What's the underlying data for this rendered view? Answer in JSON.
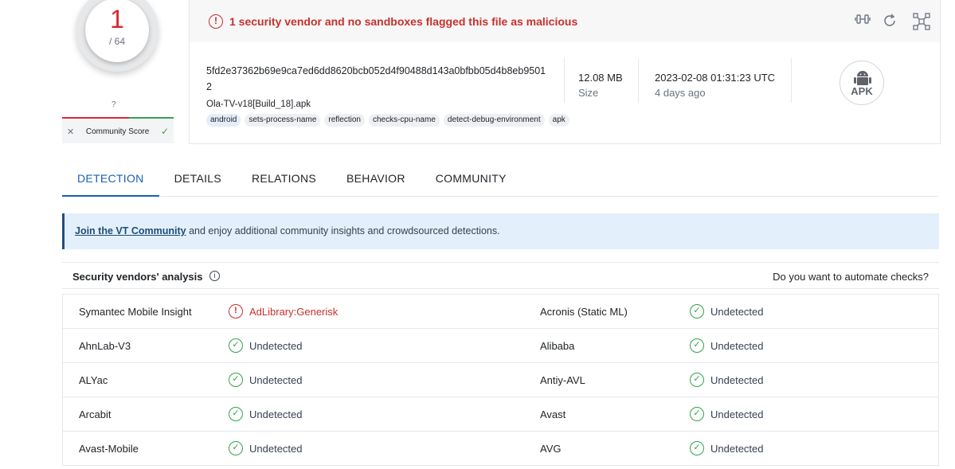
{
  "score": {
    "detections": "1",
    "total": "/ 64",
    "community_unknown": "?",
    "community_label": "Community Score",
    "vote_down_icon": "x",
    "vote_up_icon": "check"
  },
  "banner": {
    "text": "1 security vendor and no sandboxes flagged this file as malicious",
    "icon": "!"
  },
  "file": {
    "hash": "5fd2e37362b69e9ca7ed6dd8620bcb052d4f90488d143a0bfbb05d4b8eb95012",
    "name": "Ola-TV-v18[Build_18].apk",
    "tags": [
      "android",
      "sets-process-name",
      "reflection",
      "checks-cpu-name",
      "detect-debug-environment",
      "apk"
    ],
    "size_value": "12.08 MB",
    "size_label": "Size",
    "date_value": "2023-02-08 01:31:23 UTC",
    "date_label": "4 days ago",
    "type_label": "APK"
  },
  "tabs": [
    "DETECTION",
    "DETAILS",
    "RELATIONS",
    "BEHAVIOR",
    "COMMUNITY"
  ],
  "join": {
    "link": "Join the VT Community",
    "text": " and enjoy additional community insights and crowdsourced detections."
  },
  "vendors": {
    "title": "Security vendors' analysis",
    "automate": "Do you want to automate checks?",
    "rows": [
      {
        "left": {
          "name": "Symantec Mobile Insight",
          "result": "AdLibrary:Generisk",
          "malicious": true
        },
        "right": {
          "name": "Acronis (Static ML)",
          "result": "Undetected",
          "malicious": false
        }
      },
      {
        "left": {
          "name": "AhnLab-V3",
          "result": "Undetected",
          "malicious": false
        },
        "right": {
          "name": "Alibaba",
          "result": "Undetected",
          "malicious": false
        }
      },
      {
        "left": {
          "name": "ALYac",
          "result": "Undetected",
          "malicious": false
        },
        "right": {
          "name": "Antiy-AVL",
          "result": "Undetected",
          "malicious": false
        }
      },
      {
        "left": {
          "name": "Arcabit",
          "result": "Undetected",
          "malicious": false
        },
        "right": {
          "name": "Avast",
          "result": "Undetected",
          "malicious": false
        }
      },
      {
        "left": {
          "name": "Avast-Mobile",
          "result": "Undetected",
          "malicious": false
        },
        "right": {
          "name": "AVG",
          "result": "Undetected",
          "malicious": false
        }
      }
    ]
  },
  "colors": {
    "malicious": "#c7312a",
    "clean": "#31a34a",
    "accent": "#1a5fb4"
  }
}
